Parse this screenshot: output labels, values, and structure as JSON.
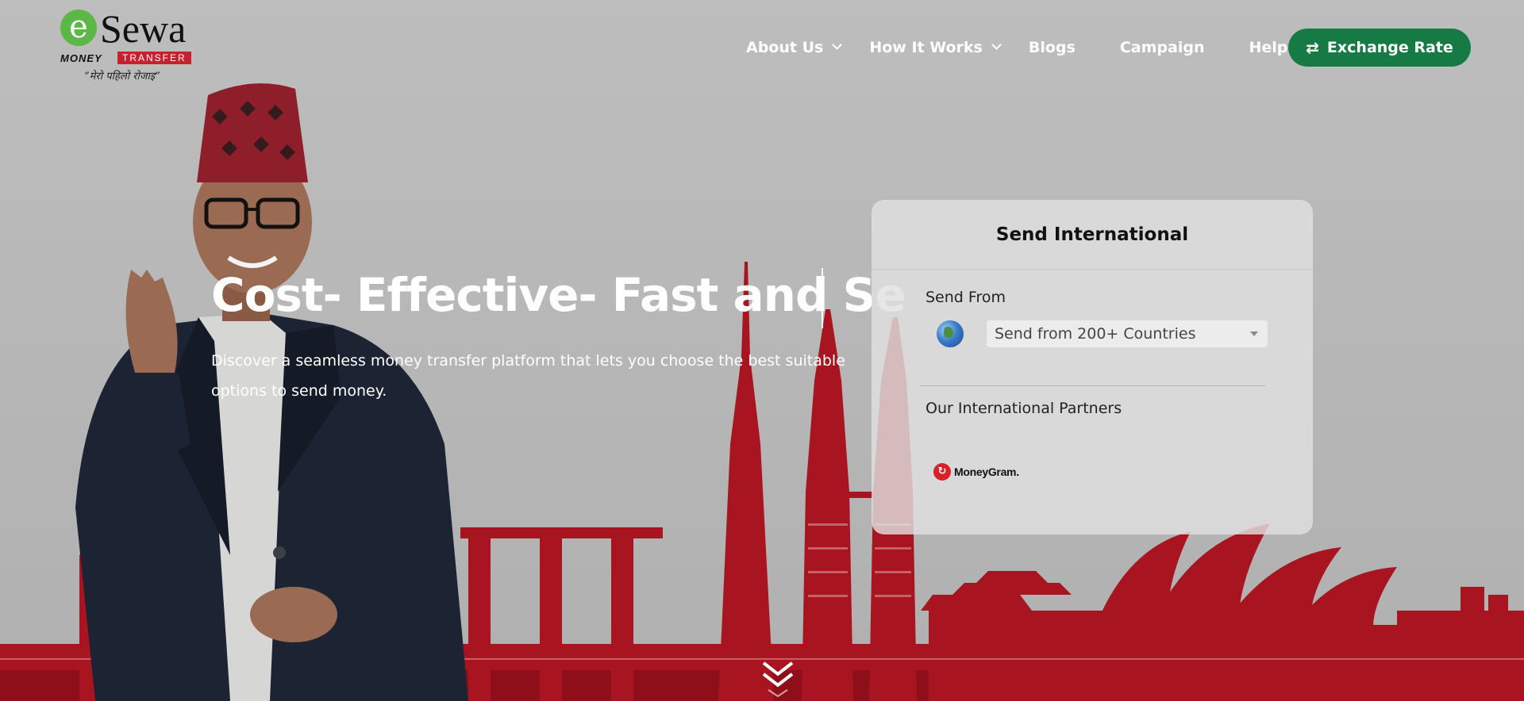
{
  "brand": {
    "logo_e": "e",
    "logo_name": "Sewa",
    "logo_money": "MONEY",
    "logo_transfer": "TRANSFER",
    "logo_tagline": "“मेरो पहिलो रोजाइ”"
  },
  "nav": {
    "items": [
      {
        "label": "About Us",
        "has_dropdown": true
      },
      {
        "label": "How It Works",
        "has_dropdown": true
      },
      {
        "label": "Blogs",
        "has_dropdown": false
      },
      {
        "label": "Campaign",
        "has_dropdown": false
      },
      {
        "label": "Help",
        "has_dropdown": true
      }
    ],
    "cta_label": "Exchange Rate",
    "cta_icon": "swap-arrows-icon"
  },
  "hero": {
    "headline": "Cost- Effective- Fast and Se",
    "subtext": "Discover a seamless money transfer platform that lets you choose the best suitable options to send money."
  },
  "card": {
    "title": "Send International",
    "send_from_label": "Send From",
    "country_select_value": "Send from 200+ Countries",
    "partners_label": "Our International Partners",
    "partners": [
      {
        "name": "MoneyGram."
      }
    ]
  },
  "colors": {
    "accent_green": "#167a45",
    "brand_red": "#c8202f",
    "skyline_red": "#a8141f"
  }
}
